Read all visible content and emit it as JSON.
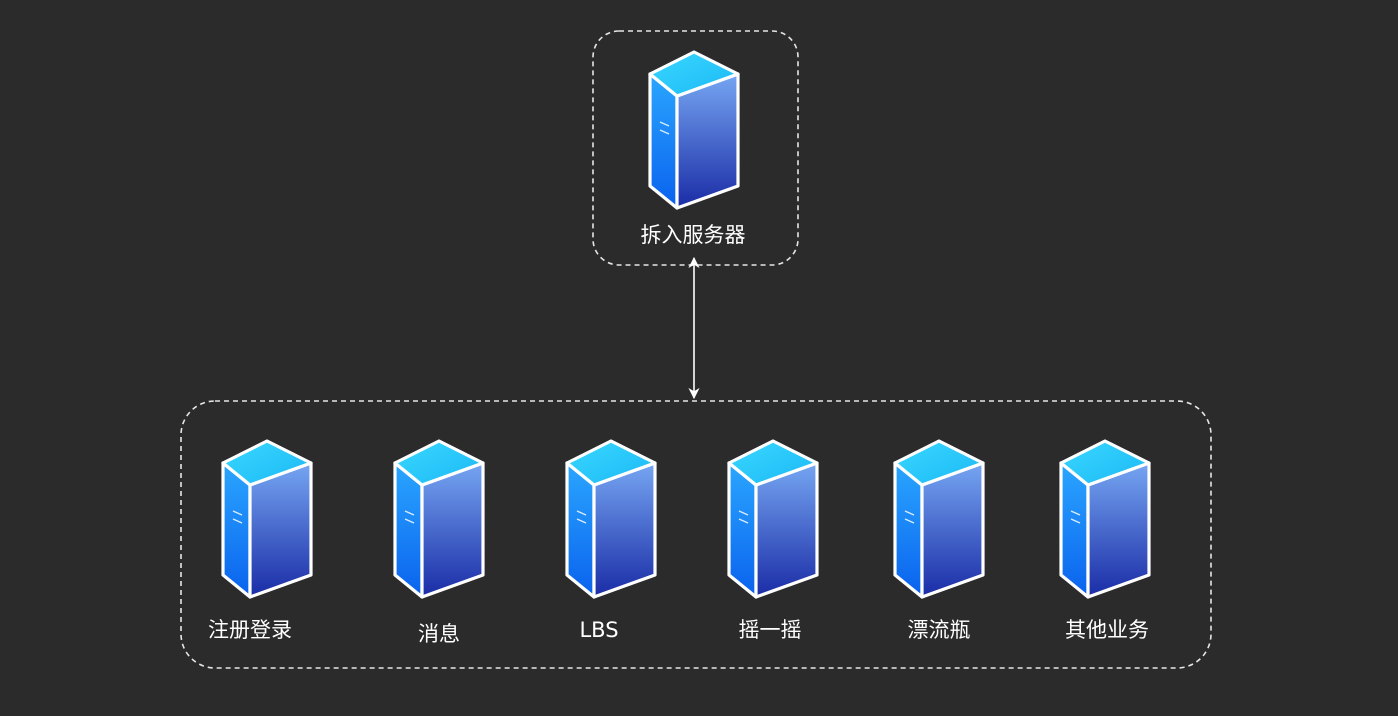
{
  "gateway": {
    "label": "拆入服务器",
    "icon": "server-icon"
  },
  "services": [
    {
      "label": "注册登录",
      "icon": "server-icon"
    },
    {
      "label": "消息",
      "icon": "server-icon"
    },
    {
      "label": "LBS",
      "icon": "server-icon"
    },
    {
      "label": "摇一摇",
      "icon": "server-icon"
    },
    {
      "label": "漂流瓶",
      "icon": "server-icon"
    },
    {
      "label": "其他业务",
      "icon": "server-icon"
    }
  ],
  "connector": {
    "type": "bidirectional-arrow",
    "from": "gateway",
    "to": "services-group"
  },
  "colors": {
    "background": "#2b2b2b",
    "group_border": "#e6e6e6",
    "text": "#ffffff",
    "server_top": "#2fd0ff",
    "server_front_light": "#1a8cff",
    "server_front_dark": "#0a5ae0",
    "server_side_light": "#6a9af0",
    "server_side_dark": "#1a2fa8"
  }
}
